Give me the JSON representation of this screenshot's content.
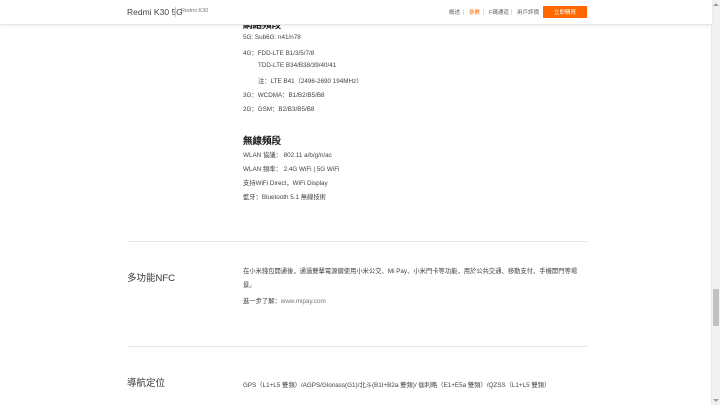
{
  "header": {
    "brand": "Redmi K30 5G",
    "sub_brand": "Redmi K30",
    "nav": [
      "概述",
      "參數",
      "F碼通道",
      "用戶評價"
    ],
    "buy_label": "立即購買",
    "active_nav": "參數",
    "accent_color": "#ff6700"
  },
  "network": {
    "heading": "網絡頻段",
    "lines": [
      "5G: Sub6G: n41/n78",
      "4G：FDD-LTE B1/3/5/7/8",
      "TDD-LTE B34/B38/39/40/41",
      "注：LTE B41（2496-2690 194MHz）",
      "3G：WCDMA：B1/B2/B5/B8",
      "2G：GSM：B2/B3/B5/B8"
    ]
  },
  "wireless": {
    "heading": "無線頻段",
    "lines": [
      "WLAN 協議： 802.11 a/b/g/n/ac",
      "WLAN 頻率： 2.4G WiFi | 5G WiFi",
      "支持WiFi Direct，WiFi Display",
      "藍牙：Bluetooth 5.1 無線技術"
    ]
  },
  "nfc": {
    "title": "多功能NFC",
    "description": "在小米錢包開通後，通過雙擊電源鍵使用小米公交、Mi Pay、小米門卡等功能，用於公共交通、移動支付、手機開門等場景。",
    "more_prefix": "進一步了解：",
    "more_link": "www.mipay.com"
  },
  "navigation": {
    "title": "導航定位",
    "text": "GPS（L1+L5 雙頻）/AGPS/Glonass(G1)/北斗(B1I+B2a 雙頻)/ 伽利略（E1+E5a 雙頻）/QZSS（L1+L5 雙頻）"
  }
}
